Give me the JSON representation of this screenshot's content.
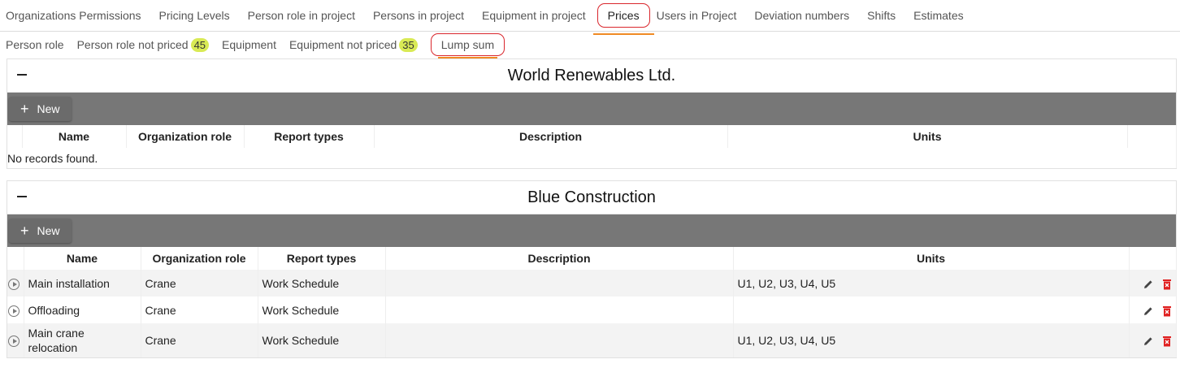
{
  "top_tabs": [
    {
      "label": "Organizations Permissions"
    },
    {
      "label": "Pricing Levels"
    },
    {
      "label": "Person role in project"
    },
    {
      "label": "Persons in project"
    },
    {
      "label": "Equipment in project"
    },
    {
      "label": "Prices",
      "active": true
    },
    {
      "label": "Users in Project"
    },
    {
      "label": "Deviation numbers"
    },
    {
      "label": "Shifts"
    },
    {
      "label": "Estimates"
    }
  ],
  "sub_tabs": [
    {
      "label": "Person role"
    },
    {
      "label": "Person role not priced",
      "badge": "45"
    },
    {
      "label": "Equipment"
    },
    {
      "label": "Equipment not priced",
      "badge": "35"
    },
    {
      "label": "Lump sum",
      "active": true
    }
  ],
  "columns": [
    "Name",
    "Organization role",
    "Report types",
    "Description",
    "Units"
  ],
  "new_label": "New",
  "panels": [
    {
      "title": "World Renewables Ltd.",
      "empty_message": "No records found.",
      "rows": []
    },
    {
      "title": "Blue Construction",
      "rows": [
        {
          "name": "Main installation",
          "role": "Crane",
          "report": "Work Schedule",
          "description": "",
          "units": "U1, U2, U3, U4, U5"
        },
        {
          "name": "Offloading",
          "role": "Crane",
          "report": "Work Schedule",
          "description": "",
          "units": ""
        },
        {
          "name": "Main crane relocation",
          "role": "Crane",
          "report": "Work Schedule",
          "description": "",
          "units": "U1, U2, U3, U4, U5"
        }
      ]
    }
  ],
  "colors": {
    "accent": "#f08a24",
    "highlight": "#d9262c",
    "badge": "#d9ea55",
    "toolbar": "#777777",
    "delete": "#e02020"
  },
  "icons": [
    "play-icon",
    "edit-icon",
    "delete-icon"
  ]
}
